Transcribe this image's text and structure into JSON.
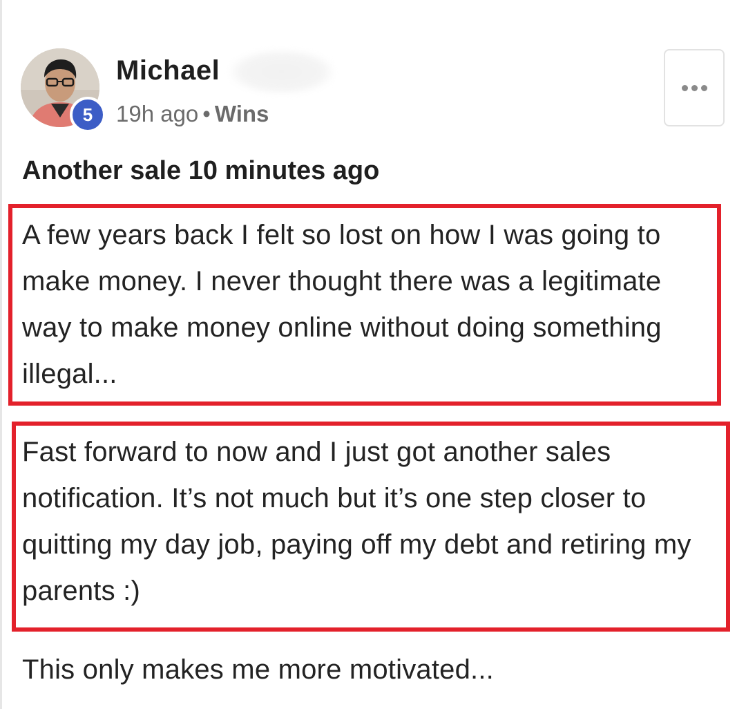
{
  "post": {
    "author": {
      "name": "Michael",
      "level": "5"
    },
    "meta": {
      "time": "19h ago",
      "separator": "•",
      "category": "Wins"
    },
    "title": "Another sale 10 minutes ago",
    "paragraphs": [
      "A few years back I felt so lost on how I was going to make money. I never thought there was a legitimate way to make money online without doing something illegal...",
      "Fast forward to now and I just got another sales notification. It’s not much but it’s one step closer to quitting my day job, paying off my debt and retiring my parents :)",
      "This only makes me more motivated..."
    ]
  },
  "icons": {
    "more": "more-horizontal-icon"
  },
  "colors": {
    "highlight": "#e3212b",
    "badge": "#3c5dc6",
    "meta_text": "#6b6b6b"
  }
}
